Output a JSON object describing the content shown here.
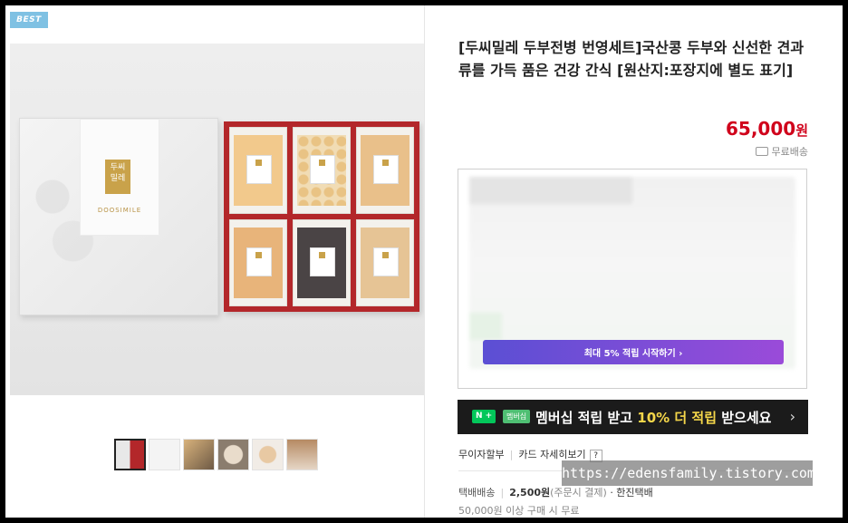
{
  "badge": {
    "label": "BEST"
  },
  "product": {
    "title": "[두씨밀레 두부전병 번영세트]국산콩 두부와 신선한 견과류를 가득 품은 건강 간식 [원산지:포장지에 별도 표기]",
    "brand_on_box": "DOOSIMILE",
    "logo_text": "두씨\n밀레"
  },
  "price": {
    "amount": "65,000",
    "currency": "원"
  },
  "shipping_badge": {
    "label": "무료배송",
    "icon": "truck-icon"
  },
  "rewards_card": {
    "cta_label": "최대 5% 적립 시작하기 ›"
  },
  "membership_banner": {
    "badge_n": "N +",
    "badge_member": "멤버십",
    "text_a": "멤버십 적립 받고 ",
    "text_highlight": "10% 더 적립",
    "text_b": " 받으세요",
    "chevron": "›"
  },
  "payment_options": {
    "installment": "무이자할부",
    "card_details": "카드 자세히보기",
    "help": "?"
  },
  "delivery": {
    "label": "택배배송",
    "fee": "2,500원",
    "note": "(주문시 결제)",
    "carrier": "· 한진택배",
    "free_condition": "50,000원 이상 구매 시 무료"
  },
  "watermark": "https://edensfamily.tistory.com",
  "thumbnails": [
    "thumbnail-gift-box",
    "thumbnail-packs",
    "thumbnail-sliced",
    "thumbnail-plate",
    "thumbnail-bowl",
    "thumbnail-cake"
  ],
  "colors": {
    "price": "#d0021b",
    "best_badge": "#7fc1e3",
    "tray": "#b3272a",
    "cta_gradient_start": "#5b4fd4",
    "cta_gradient_end": "#9a4bd9",
    "highlight": "#f4d64a",
    "naver_green": "#03c75a"
  }
}
